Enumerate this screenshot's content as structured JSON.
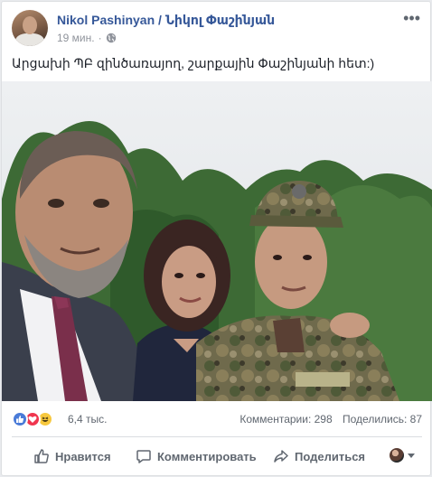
{
  "post": {
    "author": "Nikol Pashinyan / Նիկոլ Փաշինյան",
    "timestamp": "19 мин.",
    "privacy_icon": "globe-icon",
    "more_icon": "more-dots-icon",
    "text": "Արցախի ՊԲ զինծառայող, շարքային Փաշինյանի հետ:)",
    "photo": {
      "description_icon": "group-selfie-photo"
    }
  },
  "reactions": {
    "types": [
      "like",
      "love",
      "haha"
    ],
    "count": "6,4 тыс.",
    "comments": "Комментарии: 298",
    "shares": "Поделились: 87",
    "colors": {
      "like": "#4a7bd8",
      "love": "#f0364f",
      "haha": "#f7c83e"
    }
  },
  "actions": {
    "like_label": "Нравится",
    "comment_label": "Комментировать",
    "share_label": "Поделиться"
  },
  "theme": {
    "link_color": "#365899",
    "muted_text": "#90949c",
    "action_text": "#606770"
  }
}
